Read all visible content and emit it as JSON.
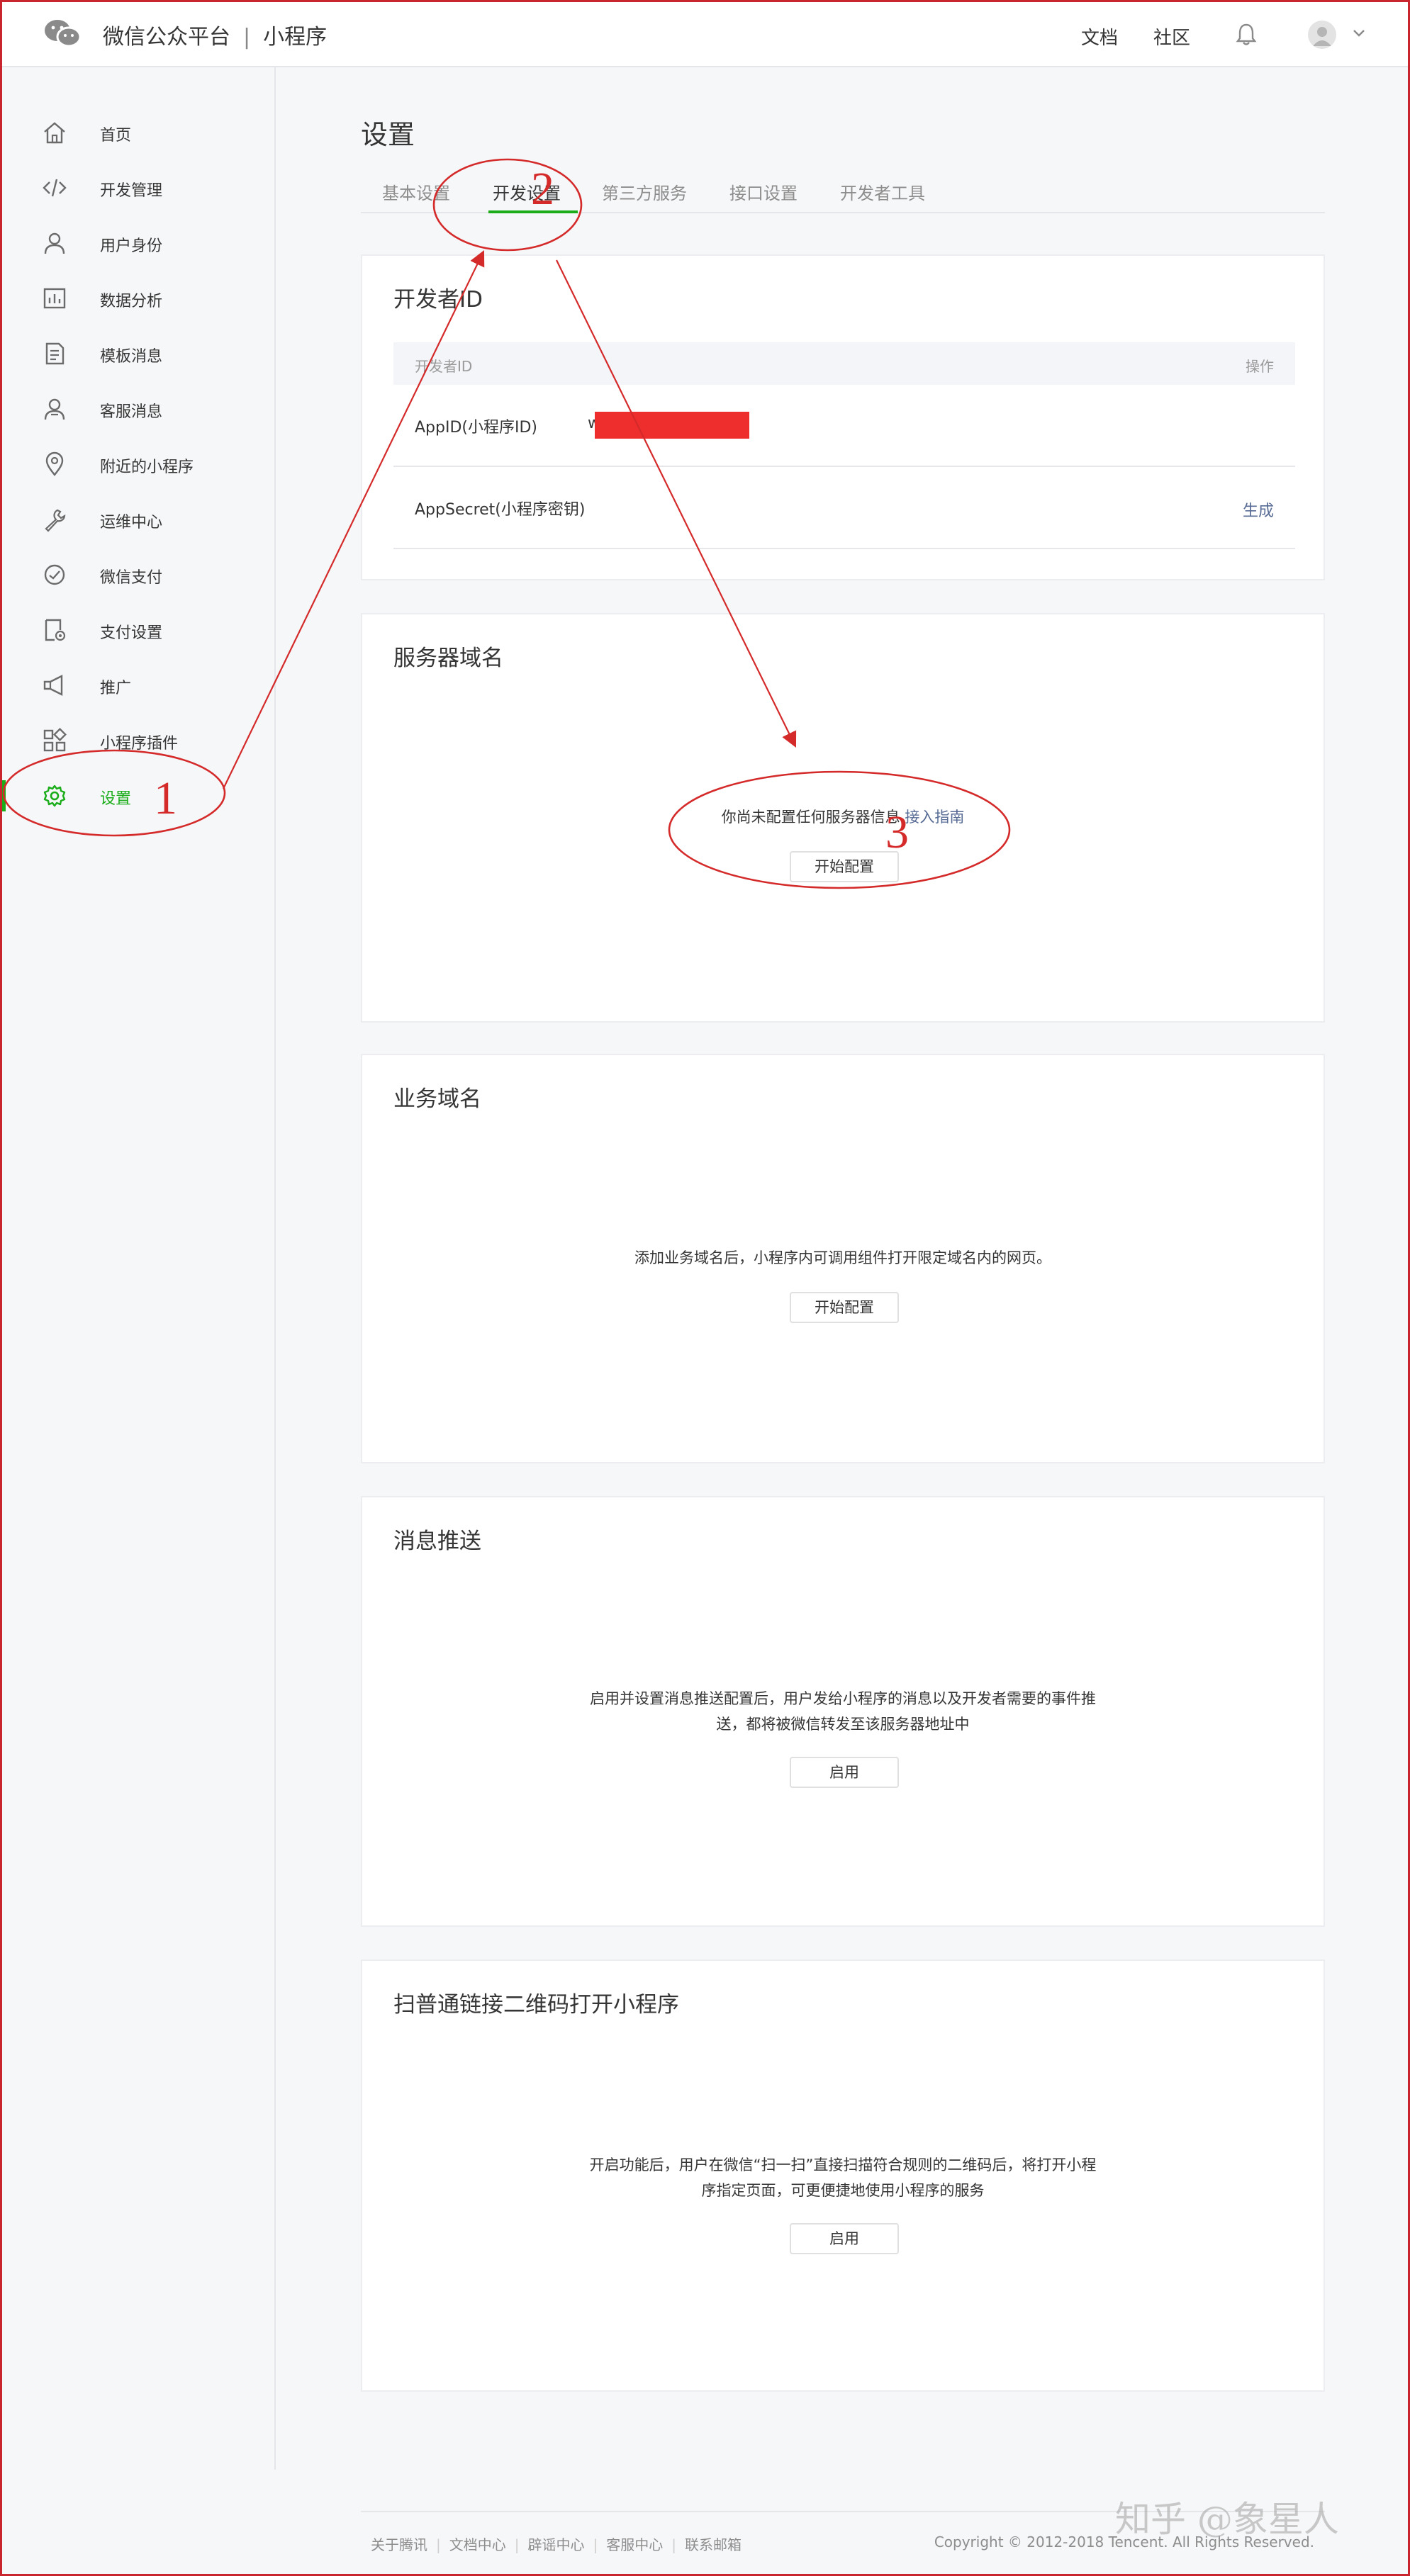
{
  "header": {
    "brand": "微信公众平台",
    "separator": "|",
    "product": "小程序",
    "links": [
      {
        "label": "文档"
      },
      {
        "label": "社区"
      }
    ],
    "icons": [
      "wechat-logo-icon",
      "bell-icon",
      "avatar-icon",
      "chevron-down-icon"
    ]
  },
  "sidebar": {
    "items": [
      {
        "label": "首页",
        "icon": "home-icon"
      },
      {
        "label": "开发管理",
        "icon": "code-icon"
      },
      {
        "label": "用户身份",
        "icon": "user-icon"
      },
      {
        "label": "数据分析",
        "icon": "chart-icon"
      },
      {
        "label": "模板消息",
        "icon": "document-icon"
      },
      {
        "label": "客服消息",
        "icon": "customer-service-icon"
      },
      {
        "label": "附近的小程序",
        "icon": "location-icon"
      },
      {
        "label": "运维中心",
        "icon": "wrench-icon"
      },
      {
        "label": "微信支付",
        "icon": "pay-icon"
      },
      {
        "label": "支付设置",
        "icon": "pay-settings-icon"
      },
      {
        "label": "推广",
        "icon": "megaphone-icon"
      },
      {
        "label": "小程序插件",
        "icon": "plugin-icon"
      },
      {
        "label": "设置",
        "icon": "gear-icon",
        "active": true
      }
    ],
    "accent_color": "#1aad19"
  },
  "main": {
    "title": "设置",
    "tabs": [
      {
        "label": "基本设置"
      },
      {
        "label": "开发设置",
        "active": true
      },
      {
        "label": "第三方服务"
      },
      {
        "label": "接口设置"
      },
      {
        "label": "开发者工具"
      }
    ],
    "developer_id": {
      "title": "开发者ID",
      "header_id": "开发者ID",
      "header_action": "操作",
      "rows": [
        {
          "key": "AppID(小程序ID)",
          "value": "w",
          "redacted": true
        },
        {
          "key": "AppSecret(小程序密钥)",
          "action": "生成"
        }
      ]
    },
    "server_domain": {
      "title": "服务器域名",
      "message": "你尚未配置任何服务器信息",
      "link": "接入指南",
      "button": "开始配置"
    },
    "business_domain": {
      "title": "业务域名",
      "message": "添加业务域名后，小程序内可调用组件打开限定域名内的网页。",
      "button": "开始配置"
    },
    "message_push": {
      "title": "消息推送",
      "message_line1": "启用并设置消息推送配置后，用户发给小程序的消息以及开发者需要的事件推",
      "message_line2": "送，都将被微信转发至该服务器地址中",
      "button": "启用"
    },
    "qrcode": {
      "title": "扫普通链接二维码打开小程序",
      "message_line1": "开启功能后，用户在微信“扫一扫”直接扫描符合规则的二维码后，将打开小程",
      "message_line2": "序指定页面，可更便捷地使用小程序的服务",
      "button": "启用"
    }
  },
  "footer": {
    "links": [
      "关于腾讯",
      "文档中心",
      "辟谣中心",
      "客服中心",
      "联系邮箱"
    ],
    "divider": "|",
    "copyright": "Copyright © 2012-2018 Tencent. All Rights Reserved."
  },
  "annotations": {
    "numbers": [
      "1",
      "2",
      "3"
    ],
    "color": "#d42a2a"
  },
  "watermark": "知乎 @象星人"
}
